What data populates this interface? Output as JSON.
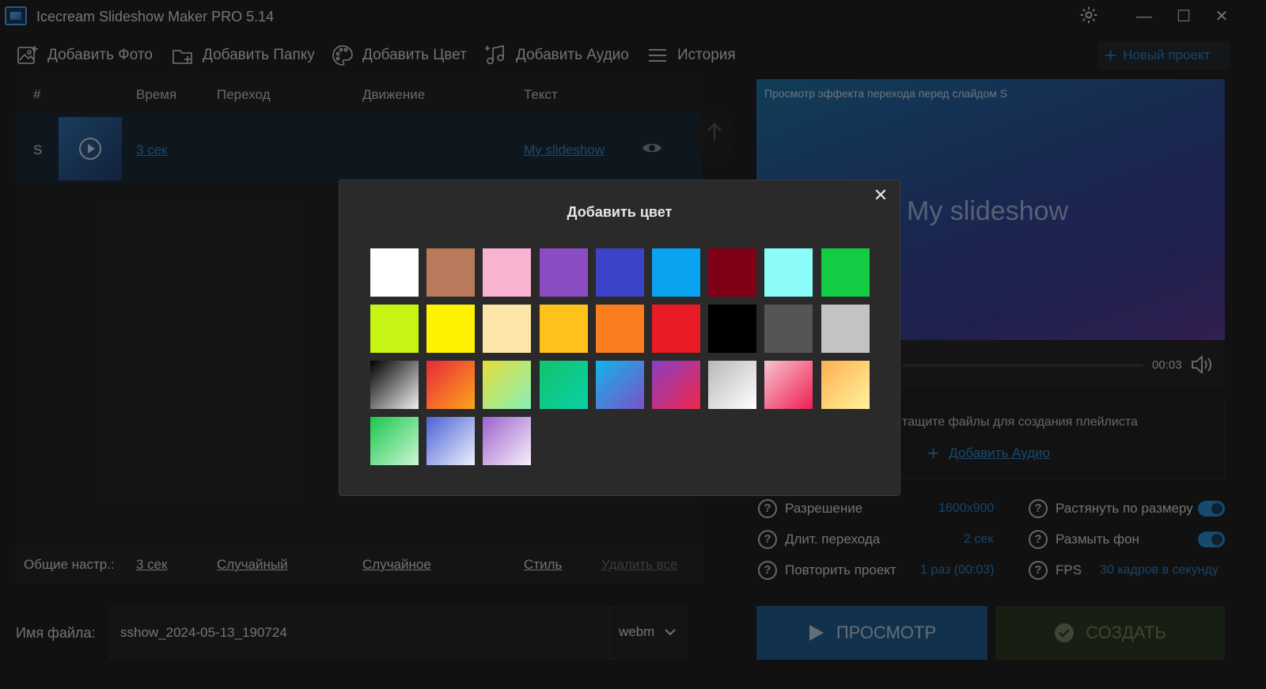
{
  "app": {
    "title": "Icecream Slideshow Maker PRO 5.14"
  },
  "toolbar": {
    "add_photo": "Добавить Фото",
    "add_folder": "Добавить Папку",
    "add_color": "Добавить Цвет",
    "add_audio": "Добавить Аудио",
    "history": "История",
    "new_project": "Новый проект"
  },
  "table": {
    "headers": [
      "#",
      "Время",
      "Переход",
      "Движение",
      "Текст"
    ],
    "rows": [
      {
        "num": "S",
        "time": "3 сек",
        "text": "My slideshow"
      }
    ]
  },
  "general_settings": {
    "label": "Общие настр.:",
    "time": "3 сек",
    "transition": "Случайный",
    "motion": "Случайное",
    "style": "Стиль",
    "delete_all": "Удалить все"
  },
  "file": {
    "label": "Имя файла:",
    "value": "sshow_2024-05-13_190724",
    "ext": "webm"
  },
  "preview": {
    "caption": "Просмотр эффекта перехода перед слайдом S",
    "title_text": "My slideshow",
    "time": "00:03"
  },
  "audio": {
    "hint": "тащите файлы для создания плейлиста",
    "add_link": "Добавить Аудио"
  },
  "options": {
    "resolution_label": "Разрешение",
    "resolution_value": "1600x900",
    "transition_label": "Длит. перехода",
    "transition_value": "2 сек",
    "repeat_label": "Повторить проект",
    "repeat_value": "1 раз (00:03)",
    "stretch_label": "Растянуть по размеру",
    "blur_label": "Размыть фон",
    "fps_label": "FPS",
    "fps_value": "30 кадров в секунду"
  },
  "buttons": {
    "preview": "ПРОСМОТР",
    "create": "СОЗДАТЬ"
  },
  "modal": {
    "title": "Добавить цвет",
    "swatches": [
      "#ffffff",
      "#b87a5a",
      "#f7b3cf",
      "#8b4cc4",
      "#3d43c8",
      "#0aa3f0",
      "#800018",
      "#8cfcf8",
      "#14cc44",
      "#c6f513",
      "#fef200",
      "#fde5a8",
      "#fec21a",
      "#fb7d1e",
      "#ea1b24",
      "#000000",
      "#555555",
      "#c3c3c3",
      "linear-gradient(135deg,#000000,#f0f0f0)",
      "linear-gradient(135deg,#e9283c,#fda51a)",
      "linear-gradient(135deg,#e6dd3a,#86f0b8)",
      "linear-gradient(135deg,#12c46a,#0ad0a8)",
      "linear-gradient(135deg,#13b4ea,#7a52c8)",
      "linear-gradient(135deg,#8a3ec4,#f0274a)",
      "linear-gradient(135deg,#b8b8b8,#ffffff)",
      "linear-gradient(135deg,#f8c3cf,#ee1f52)",
      "linear-gradient(135deg,#fdb04c,#fff2a0)",
      "linear-gradient(135deg,#18c84c,#cff6d6)",
      "linear-gradient(135deg,#4a62d8,#eef0fa)",
      "linear-gradient(135deg,#9c62cc,#f7f0fb)"
    ]
  }
}
